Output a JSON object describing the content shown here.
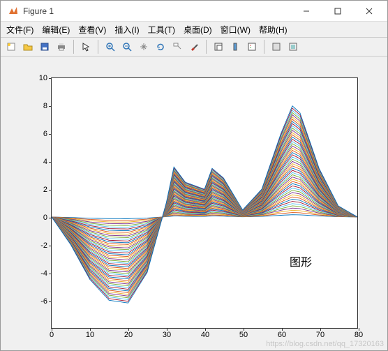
{
  "window": {
    "title": "Figure 1"
  },
  "menu": {
    "file": "文件(F)",
    "edit": "编辑(E)",
    "view": "查看(V)",
    "insert": "插入(I)",
    "tools": "工具(T)",
    "desktop": "桌面(D)",
    "window_": "窗口(W)",
    "help": "帮助(H)"
  },
  "annotation": {
    "figure_label": "图形"
  },
  "watermark": "https://blog.csdn.net/qq_17320163",
  "chart_data": {
    "type": "line",
    "title": "",
    "xlabel": "",
    "ylabel": "",
    "xlim": [
      0,
      80
    ],
    "ylim": [
      -8,
      10
    ],
    "xticks": [
      0,
      10,
      20,
      30,
      40,
      50,
      60,
      70,
      80
    ],
    "yticks": [
      -6,
      -4,
      -2,
      0,
      2,
      4,
      6,
      8,
      10
    ],
    "grid": false,
    "annotation": {
      "text": "图形",
      "x": 62,
      "y": -2.5
    },
    "description": "Envelope of ~50 curves. Each curve k (k=1..50) has amplitude scale s=k/50 applied to the base waveform y(x) sampled at x=0..80.",
    "base_curve": {
      "x": [
        0,
        5,
        10,
        15,
        20,
        25,
        30,
        32,
        35,
        40,
        42,
        45,
        50,
        55,
        60,
        63,
        65,
        70,
        75,
        80
      ],
      "y": [
        0,
        -2.0,
        -4.5,
        -6.0,
        -6.2,
        -4.0,
        1.0,
        3.6,
        2.5,
        2.0,
        3.5,
        2.8,
        0.5,
        2.0,
        6.0,
        8.0,
        7.5,
        3.5,
        0.8,
        0
      ]
    },
    "series_count": 50,
    "color_cycle": [
      "#0072BD",
      "#D95319",
      "#EDB120",
      "#7E2F8E",
      "#77AC30",
      "#4DBEEE",
      "#A2142F"
    ]
  }
}
